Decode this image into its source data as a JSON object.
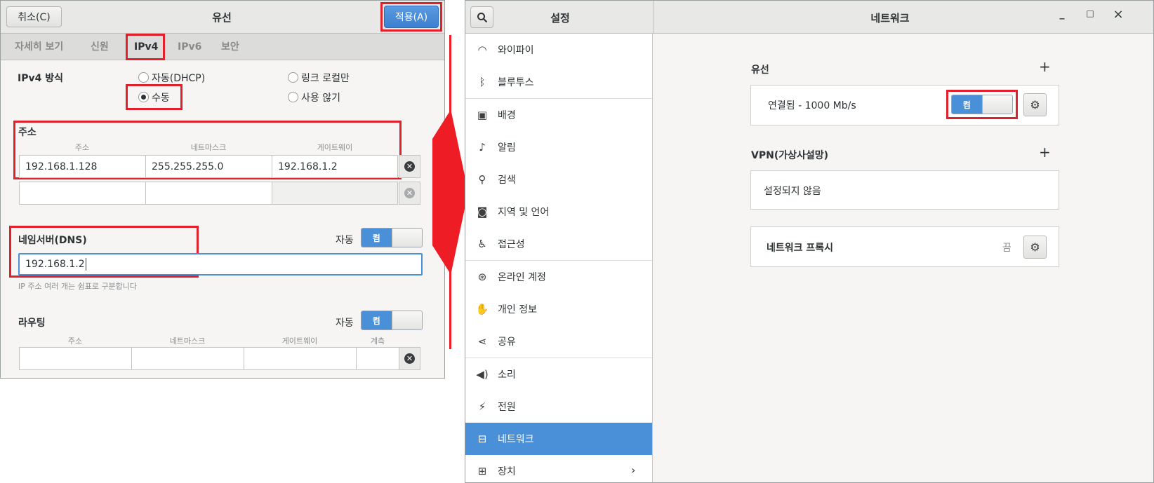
{
  "dialog": {
    "cancel_label": "취소(C)",
    "title": "유선",
    "apply_label": "적용(A)",
    "tabs": [
      "자세히 보기",
      "신원",
      "IPv4",
      "IPv6",
      "보안"
    ],
    "ipv4_method_label": "IPv4 방식",
    "methods": {
      "auto_dhcp": "자동(DHCP)",
      "link_local": "링크 로컬만",
      "manual": "수동",
      "disabled": "사용 않기",
      "selected": "수동"
    },
    "address": {
      "section_label": "주소",
      "headers": [
        "주소",
        "네트마스크",
        "게이트웨이"
      ],
      "rows": [
        {
          "address": "192.168.1.128",
          "netmask": "255.255.255.0",
          "gateway": "192.168.1.2"
        },
        {
          "address": "",
          "netmask": "",
          "gateway": ""
        }
      ]
    },
    "dns": {
      "label": "네임서버(DNS)",
      "auto_label": "자동",
      "switch_label": "켬",
      "value": "192.168.1.2",
      "hint": "IP 주소 여러 개는 쉼표로 구분합니다"
    },
    "routing": {
      "label": "라우팅",
      "auto_label": "자동",
      "switch_label": "켬",
      "headers": [
        "주소",
        "네트마스크",
        "게이트웨이",
        "계측"
      ]
    }
  },
  "settings": {
    "search_icon": "search-icon",
    "sidebar_title": "설정",
    "panel_title": "네트워크",
    "window_controls": [
      "_",
      "□",
      "×"
    ],
    "sidebar": [
      {
        "label": "와이파이",
        "icon": "wifi-icon"
      },
      {
        "label": "블루투스",
        "icon": "bluetooth-icon"
      },
      {
        "label": "배경",
        "icon": "background-icon"
      },
      {
        "label": "알림",
        "icon": "bell-icon"
      },
      {
        "label": "검색",
        "icon": "search-icon"
      },
      {
        "label": "지역 및 언어",
        "icon": "region-icon"
      },
      {
        "label": "접근성",
        "icon": "accessibility-icon"
      },
      {
        "label": "온라인 계정",
        "icon": "online-accounts-icon"
      },
      {
        "label": "개인 정보",
        "icon": "hand-icon"
      },
      {
        "label": "공유",
        "icon": "share-icon"
      },
      {
        "label": "소리",
        "icon": "speaker-icon"
      },
      {
        "label": "전원",
        "icon": "power-icon"
      },
      {
        "label": "네트워크",
        "icon": "network-icon",
        "selected": true
      },
      {
        "label": "장치",
        "icon": "devices-icon"
      }
    ],
    "wired": {
      "heading": "유선",
      "status": "연결됨 - 1000 Mb/s",
      "switch_label": "켬"
    },
    "vpn": {
      "heading": "VPN(가상사설망)",
      "status": "설정되지 않음"
    },
    "proxy": {
      "label": "네트워크 프록시",
      "status": "끔"
    }
  },
  "colors": {
    "accent": "#4a90d9",
    "highlight": "#e0202a"
  }
}
